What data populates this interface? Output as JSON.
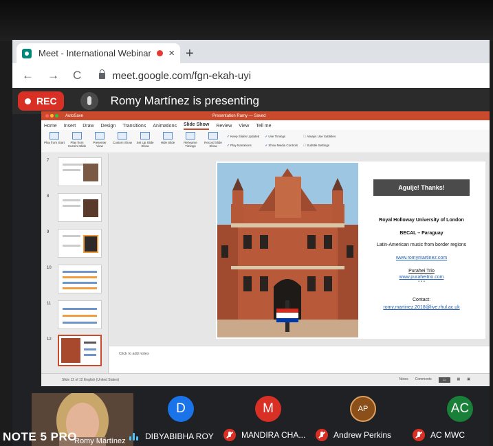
{
  "browser": {
    "tab_title": "Meet - International Webinar",
    "tab_close": "×",
    "new_tab": "+",
    "back": "←",
    "forward": "→",
    "reload": "C",
    "url": "meet.google.com/fgn-ekah-uyi"
  },
  "meet": {
    "rec_label": "REC",
    "presenting_text": "Romy Martínez is presenting"
  },
  "powerpoint": {
    "autosave": "AutoSave",
    "document_title": "Presentation Ramy — Saved",
    "menu": [
      "Home",
      "Insert",
      "Draw",
      "Design",
      "Transitions",
      "Animations",
      "Slide Show",
      "Review",
      "View",
      "Tell me"
    ],
    "active_menu": "Slide Show",
    "ribbon": {
      "buttons": [
        "Play from Start",
        "Play from Current Slide",
        "Presenter View",
        "Custom Show",
        "Set Up Slide Show",
        "Hide Slide",
        "Rehearse Timings",
        "Record Slide Show"
      ],
      "checks": [
        "Keep Slides Updated",
        "Use Timings",
        "Play Narrations",
        "Show Media Controls"
      ],
      "subtitle_check": "Always Use Subtitles",
      "subtitle_settings": "Subtitle Settings"
    },
    "thumb_numbers": [
      "7",
      "8",
      "9",
      "10",
      "11",
      "12"
    ],
    "slide": {
      "thanks": "Aguije! Thanks!",
      "university": "Royal Holloway University of London",
      "becal": "BECAL – Paraguay",
      "music": "Latin-American music from border regions",
      "website": "www.romymartinez.com",
      "trio": "Purahei Trio",
      "trio_site": "www.puraheitrio.com",
      "contact_label": "Contact:",
      "email": "romy.martinez.2018@live.rhul.ac.uk"
    },
    "notes_placeholder": "Click to add notes",
    "status_left": "Slide 12 of 12   English (United States)",
    "status_notes": "Notes",
    "status_comments": "Comments"
  },
  "participants": [
    {
      "name": "DIBYABIBHA ROY",
      "initial": "D",
      "color": "#1a73e8",
      "muted": false
    },
    {
      "name": "MANDIRA CHA...",
      "initial": "M",
      "color": "#d93025",
      "muted": true
    },
    {
      "name": "Andrew Perkins",
      "initial": "AP",
      "color": "#8b4f1a",
      "muted": true
    },
    {
      "name": "AC MWC",
      "initial": "AC",
      "color": "#188038",
      "muted": true
    }
  ],
  "self_name": "Romy Martínez",
  "watermark": "NOTE 5 PRO",
  "colors": {
    "rec": "#d93025",
    "ppt_accent": "#c94a2c",
    "link": "#1f5fb8"
  }
}
